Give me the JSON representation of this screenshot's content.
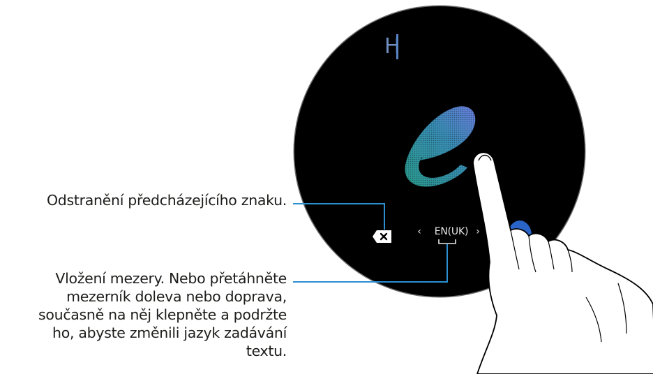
{
  "callouts": {
    "delete": "Odstranění předcházejícího znaku.",
    "space": [
      "Vložení mezery. Nebo přetáhněte",
      "mezerník doleva nebo doprava,",
      "současně na něj klepněte a podržte",
      "ho, abyste změnili jazyk zadávání",
      "textu."
    ]
  },
  "watch": {
    "typed_text": "H",
    "handwritten_glyph": "e",
    "language": {
      "prev_icon": "chevron-left-icon",
      "label": "EN(UK)",
      "next_icon": "chevron-right-icon"
    },
    "delete_icon": "backspace-icon",
    "space_icon": "spacebar-icon",
    "action_button_icon": "blue-circle-button"
  },
  "colors": {
    "callout_line": "#2b8fd1",
    "watch_bg": "#000000",
    "text_cursor": "#5a86c8",
    "handwriting_gradient_start": "#2a9d8f",
    "handwriting_gradient_end": "#5a7fd6",
    "action_button": "#2a64c8"
  }
}
